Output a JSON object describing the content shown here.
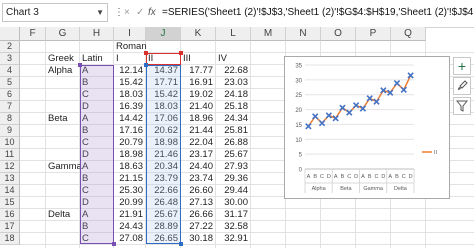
{
  "formula_bar": {
    "name_box": "Chart 3",
    "cancel_glyph": "×",
    "enter_glyph": "✓",
    "fx_label": "fx",
    "formula": "=SERIES('Sheet1 (2)'!$J$3,'Sheet1 (2)'!$G$4:$H$19,'Sheet1 (2)'!$J$4:$J$19,1)"
  },
  "columns": [
    "F",
    "G",
    "H",
    "I",
    "J",
    "K",
    "L",
    "M",
    "N",
    "O",
    "P",
    "Q"
  ],
  "selected_column": "J",
  "rows": [
    "2",
    "3",
    "4",
    "5",
    "6",
    "7",
    "8",
    "9",
    "10",
    "11",
    "12",
    "13",
    "14",
    "15",
    "16",
    "17",
    "18"
  ],
  "sheet": {
    "header_roman": "Roman",
    "header_greek": "Greek",
    "header_latin": "Latin",
    "header_i": "I",
    "header_ii": "II",
    "header_iii": "III",
    "header_iv": "IV",
    "greek": [
      "Alpha",
      "",
      "",
      "",
      "Beta",
      "",
      "",
      "",
      "Gamma",
      "",
      "",
      "",
      "Delta",
      "",
      "",
      ""
    ],
    "latin": [
      "A",
      "B",
      "C",
      "D",
      "A",
      "B",
      "C",
      "D",
      "A",
      "B",
      "C",
      "D",
      "A",
      "B",
      "C"
    ],
    "col_i": [
      "12.14",
      "15.42",
      "18.03",
      "16.39",
      "14.42",
      "17.16",
      "20.79",
      "18.98",
      "18.63",
      "21.15",
      "25.30",
      "20.99",
      "21.91",
      "24.43",
      "27.08"
    ],
    "col_ii": [
      "14.37",
      "17.71",
      "15.42",
      "18.03",
      "17.06",
      "20.62",
      "18.98",
      "21.46",
      "20.34",
      "23.79",
      "22.66",
      "26.48",
      "25.67",
      "28.89",
      "26.65"
    ],
    "col_iii": [
      "17.77",
      "16.91",
      "19.02",
      "21.40",
      "18.96",
      "21.44",
      "22.04",
      "23.17",
      "24.40",
      "23.74",
      "26.60",
      "27.13",
      "26.66",
      "27.22",
      "30.18"
    ],
    "col_iv": [
      "22.68",
      "23.03",
      "24.18",
      "25.18",
      "24.34",
      "25.81",
      "26.88",
      "25.67",
      "27.93",
      "29.36",
      "29.44",
      "30.00",
      "31.17",
      "32.58",
      "32.91"
    ]
  },
  "chart_data": {
    "type": "line",
    "categories": [
      "A",
      "B",
      "C",
      "D",
      "A",
      "B",
      "C",
      "D",
      "A",
      "B",
      "C",
      "D",
      "A",
      "B",
      "C",
      "D"
    ],
    "groups": [
      {
        "name": "Alpha",
        "span": 4
      },
      {
        "name": "Beta",
        "span": 4
      },
      {
        "name": "Gamma",
        "span": 4
      },
      {
        "name": "Delta",
        "span": 4
      }
    ],
    "series": [
      {
        "name": "II",
        "values": [
          14.37,
          17.71,
          15.42,
          18.03,
          17.06,
          20.62,
          18.98,
          21.46,
          20.34,
          23.79,
          22.66,
          26.48,
          25.67,
          28.89,
          26.65,
          31.5
        ]
      }
    ],
    "yticks": [
      0,
      5,
      10,
      15,
      20,
      25,
      30,
      35
    ],
    "ylim": [
      0,
      35
    ],
    "legend": "right",
    "legend_label": "II",
    "grid": true,
    "colors": {
      "line": "#ed7d31",
      "marker": "#4472c4"
    }
  },
  "side_buttons": [
    "+",
    "brush",
    "filter"
  ]
}
